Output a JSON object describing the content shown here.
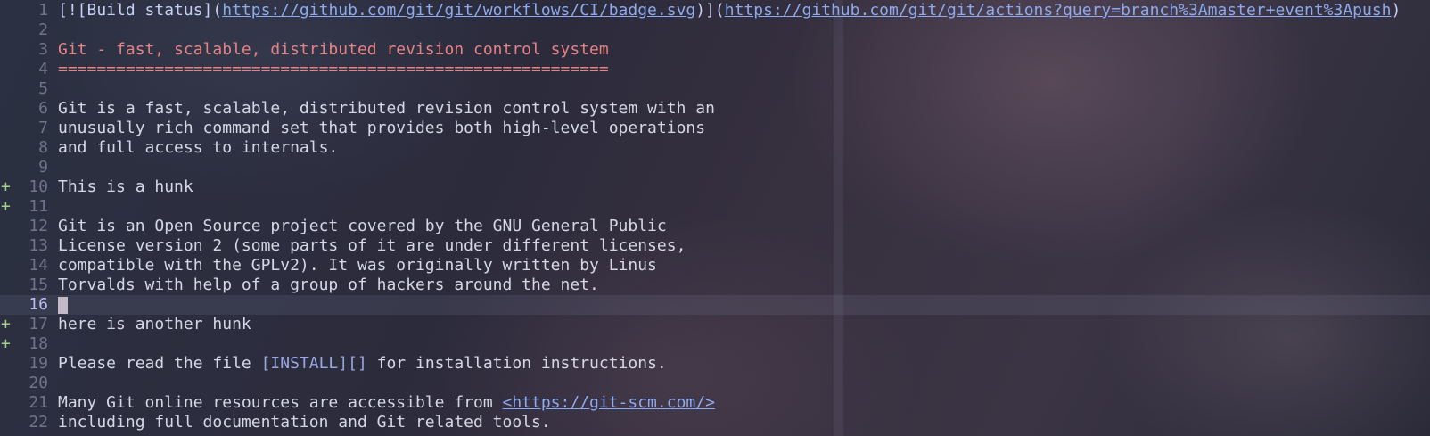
{
  "lines": [
    {
      "n": "1",
      "sign": "",
      "segments": [
        {
          "text": "[![Build status](",
          "cls": "bracket"
        },
        {
          "text": "https://github.com/git/git/workflows/CI/badge.svg",
          "cls": "link"
        },
        {
          "text": ")](",
          "cls": "bracket"
        },
        {
          "text": "https://github.com/git/git/actions?query=branch%3Amaster+event%3Apush",
          "cls": "link"
        },
        {
          "text": ")",
          "cls": "bracket"
        }
      ]
    },
    {
      "n": "2",
      "sign": "",
      "segments": []
    },
    {
      "n": "3",
      "sign": "",
      "segments": [
        {
          "text": "Git - fast, scalable, distributed revision control system",
          "cls": "heading"
        }
      ]
    },
    {
      "n": "4",
      "sign": "",
      "segments": [
        {
          "text": "=========================================================",
          "cls": "underline"
        }
      ]
    },
    {
      "n": "5",
      "sign": "",
      "segments": []
    },
    {
      "n": "6",
      "sign": "",
      "segments": [
        {
          "text": "Git is a fast, scalable, distributed revision control system with an",
          "cls": "plain"
        }
      ]
    },
    {
      "n": "7",
      "sign": "",
      "segments": [
        {
          "text": "unusually rich command set that provides both high-level operations",
          "cls": "plain"
        }
      ]
    },
    {
      "n": "8",
      "sign": "",
      "segments": [
        {
          "text": "and full access to internals.",
          "cls": "plain"
        }
      ]
    },
    {
      "n": "9",
      "sign": "",
      "segments": []
    },
    {
      "n": "10",
      "sign": "+",
      "segments": [
        {
          "text": "This is a hunk",
          "cls": "plain"
        }
      ]
    },
    {
      "n": "11",
      "sign": "+",
      "segments": []
    },
    {
      "n": "12",
      "sign": "",
      "segments": [
        {
          "text": "Git is an Open Source project covered by the GNU General Public",
          "cls": "plain"
        }
      ]
    },
    {
      "n": "13",
      "sign": "",
      "segments": [
        {
          "text": "License version 2 (some parts of it are under different licenses,",
          "cls": "plain"
        }
      ]
    },
    {
      "n": "14",
      "sign": "",
      "segments": [
        {
          "text": "compatible with the GPLv2). It was originally written by Linus",
          "cls": "plain"
        }
      ]
    },
    {
      "n": "15",
      "sign": "",
      "segments": [
        {
          "text": "Torvalds with help of a group of hackers around the net.",
          "cls": "plain"
        }
      ]
    },
    {
      "n": "16",
      "sign": "",
      "active": true,
      "cursor": true,
      "segments": []
    },
    {
      "n": "17",
      "sign": "+",
      "segments": [
        {
          "text": "here is another hunk",
          "cls": "plain"
        }
      ]
    },
    {
      "n": "18",
      "sign": "+",
      "segments": []
    },
    {
      "n": "19",
      "sign": "",
      "segments": [
        {
          "text": "Please read the file ",
          "cls": "plain"
        },
        {
          "text": "[INSTALL][]",
          "cls": "ref"
        },
        {
          "text": " for installation instructions.",
          "cls": "plain"
        }
      ]
    },
    {
      "n": "20",
      "sign": "",
      "segments": []
    },
    {
      "n": "21",
      "sign": "",
      "segments": [
        {
          "text": "Many Git online resources are accessible from ",
          "cls": "plain"
        },
        {
          "text": "<https://git-scm.com/>",
          "cls": "link"
        }
      ]
    },
    {
      "n": "22",
      "sign": "",
      "segments": [
        {
          "text": "including full documentation and Git related tools.",
          "cls": "plain"
        }
      ]
    }
  ]
}
